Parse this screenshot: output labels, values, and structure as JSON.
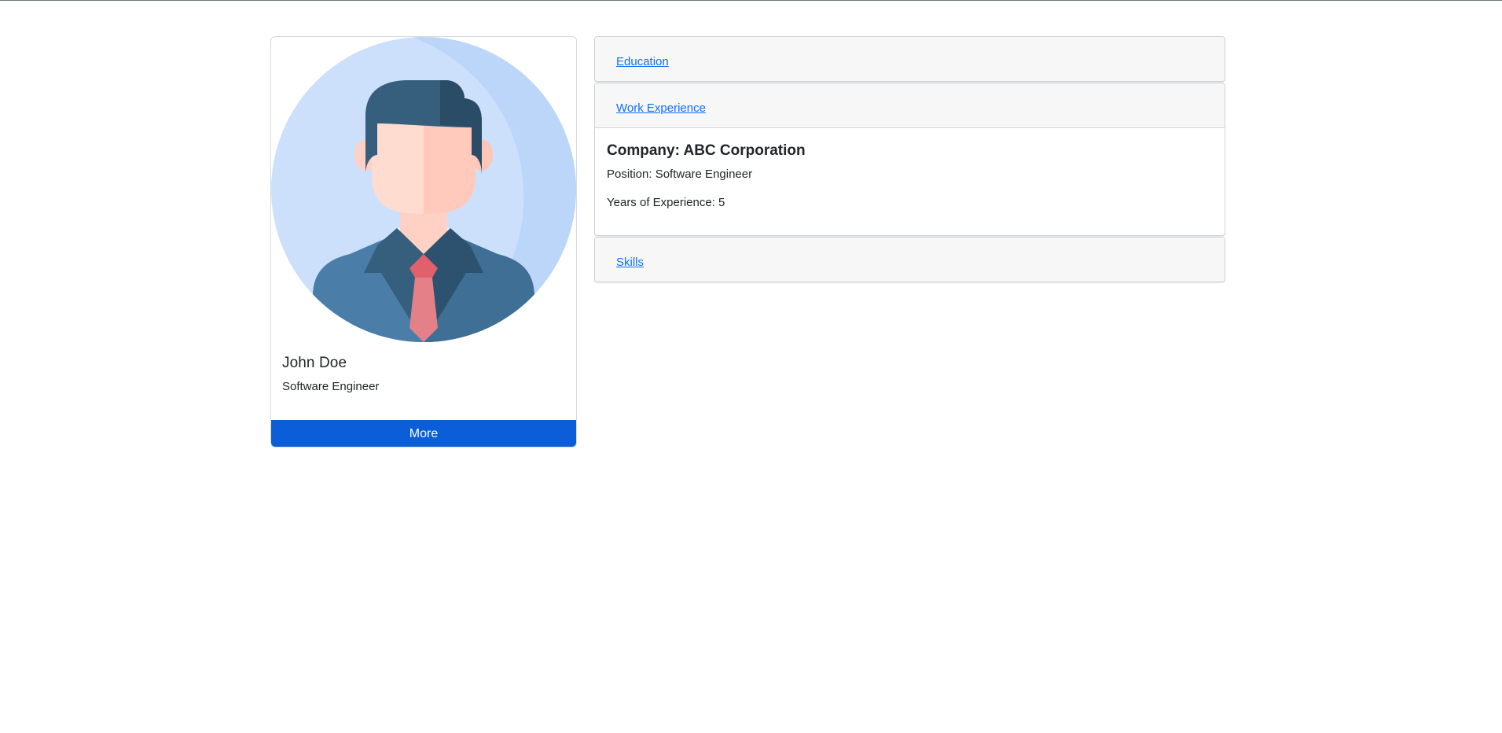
{
  "profile": {
    "name": "John Doe",
    "title": "Software Engineer",
    "more_label": "More",
    "avatar_icon": "businessman-avatar-icon"
  },
  "accordion": {
    "sections": [
      {
        "label": "Education",
        "expanded": false
      },
      {
        "label": "Work Experience",
        "expanded": true
      },
      {
        "label": "Skills",
        "expanded": false
      }
    ],
    "work_experience": {
      "company": "Company: ABC Corporation",
      "position": "Position: Software Engineer",
      "years": "Years of Experience: 5"
    }
  },
  "colors": {
    "primary": "#0b5ed7",
    "link": "#0d6efd",
    "header_bg": "#f7f7f7",
    "avatar_bg": "#cce0fc",
    "avatar_bg_dark": "#bcd6fa",
    "suit": "#4a7ea8",
    "hair": "#365e7d",
    "tie": "#e48088",
    "skin": "#ffdbd0"
  }
}
